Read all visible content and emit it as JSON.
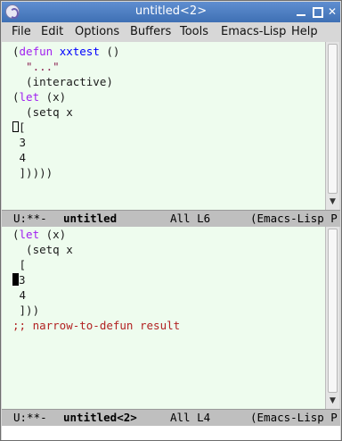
{
  "window": {
    "title": "untitled<2>"
  },
  "menu": [
    "File",
    "Edit",
    "Options",
    "Buffers",
    "Tools",
    "Emacs-Lisp",
    "Help"
  ],
  "pane1": {
    "lines": [
      {
        "kw_open": "(",
        "kw": "defun",
        "space": " ",
        "fn": "xxtest",
        "rest": " ()"
      },
      {
        "str": "  \"...\""
      },
      {
        "plain": "  (interactive)"
      },
      {
        "open": "(",
        "kw": "let",
        "rest": " (x)"
      },
      {
        "plain": "  (setq x"
      },
      {
        "after_cursor": "["
      },
      {
        "plain": " 3"
      },
      {
        "plain": " 4"
      },
      {
        "plain": " ]))))"
      }
    ]
  },
  "modeline1": {
    "status": "U:**-",
    "buffer": "untitled",
    "position": "All L6",
    "mode": "(Emacs-Lisp P"
  },
  "pane2": {
    "lines": [
      {
        "open": "(",
        "kw": "let",
        "rest": " (x)"
      },
      {
        "plain": "  (setq x"
      },
      {
        "plain": " ["
      },
      {
        "after_cursor": "3"
      },
      {
        "plain": " 4"
      },
      {
        "plain": " ]))"
      },
      {
        "comment": ";; narrow-to-defun result"
      }
    ]
  },
  "modeline2": {
    "status": "U:**-",
    "buffer": "untitled<2>",
    "position": "All L4",
    "mode": "(Emacs-Lisp P"
  },
  "icons": {
    "app": "emacs-icon",
    "minimize": "minimize-icon",
    "maximize": "maximize-icon",
    "close": "close-icon"
  }
}
